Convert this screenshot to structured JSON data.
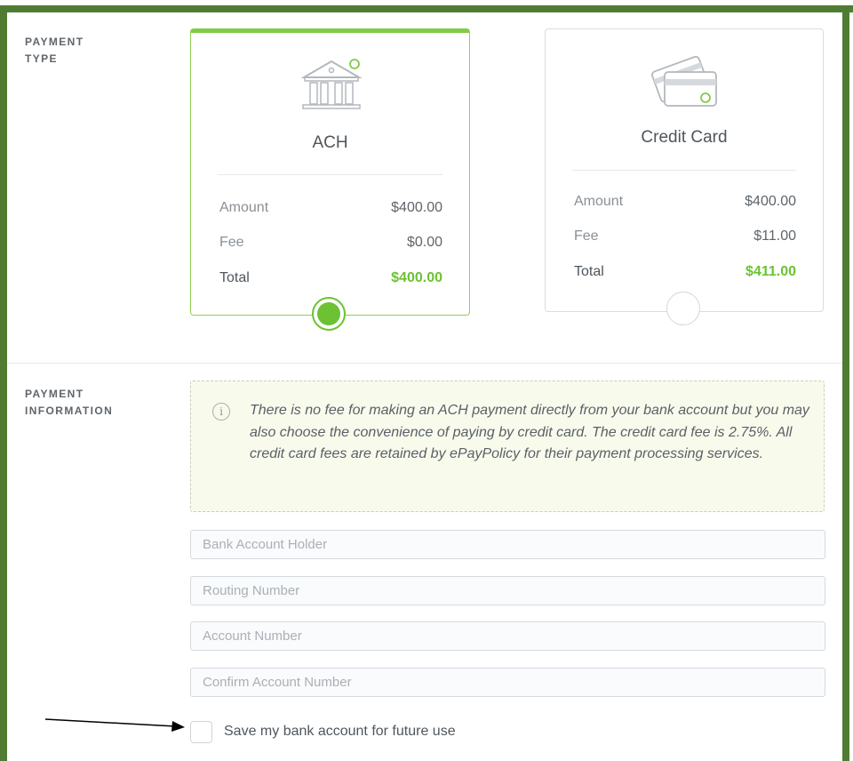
{
  "payment_type": {
    "label": "PAYMENT\nTYPE",
    "options": [
      {
        "name": "ACH",
        "icon": "bank-icon",
        "selected": true,
        "rows": {
          "amount_label": "Amount",
          "amount_value": "$400.00",
          "fee_label": "Fee",
          "fee_value": "$0.00",
          "total_label": "Total",
          "total_value": "$400.00"
        }
      },
      {
        "name": "Credit Card",
        "icon": "credit-card-icon",
        "selected": false,
        "rows": {
          "amount_label": "Amount",
          "amount_value": "$400.00",
          "fee_label": "Fee",
          "fee_value": "$11.00",
          "total_label": "Total",
          "total_value": "$411.00"
        }
      }
    ]
  },
  "payment_information": {
    "label": "PAYMENT\nINFORMATION",
    "notice": "There is no fee for making an ACH payment directly from your bank account but you may also choose the convenience of paying by credit card. The credit card fee is 2.75%. All credit card fees are retained by ePayPolicy for their payment processing services.",
    "fields": [
      {
        "placeholder": "Bank Account Holder"
      },
      {
        "placeholder": "Routing Number"
      },
      {
        "placeholder": "Account Number"
      },
      {
        "placeholder": "Confirm Account Number"
      }
    ],
    "save_checkbox": {
      "label": "Save my bank account for future use",
      "checked": false
    }
  },
  "colors": {
    "frame": "#4f7c32",
    "accent": "#6cc232",
    "notice_bg": "#f8fbec"
  }
}
